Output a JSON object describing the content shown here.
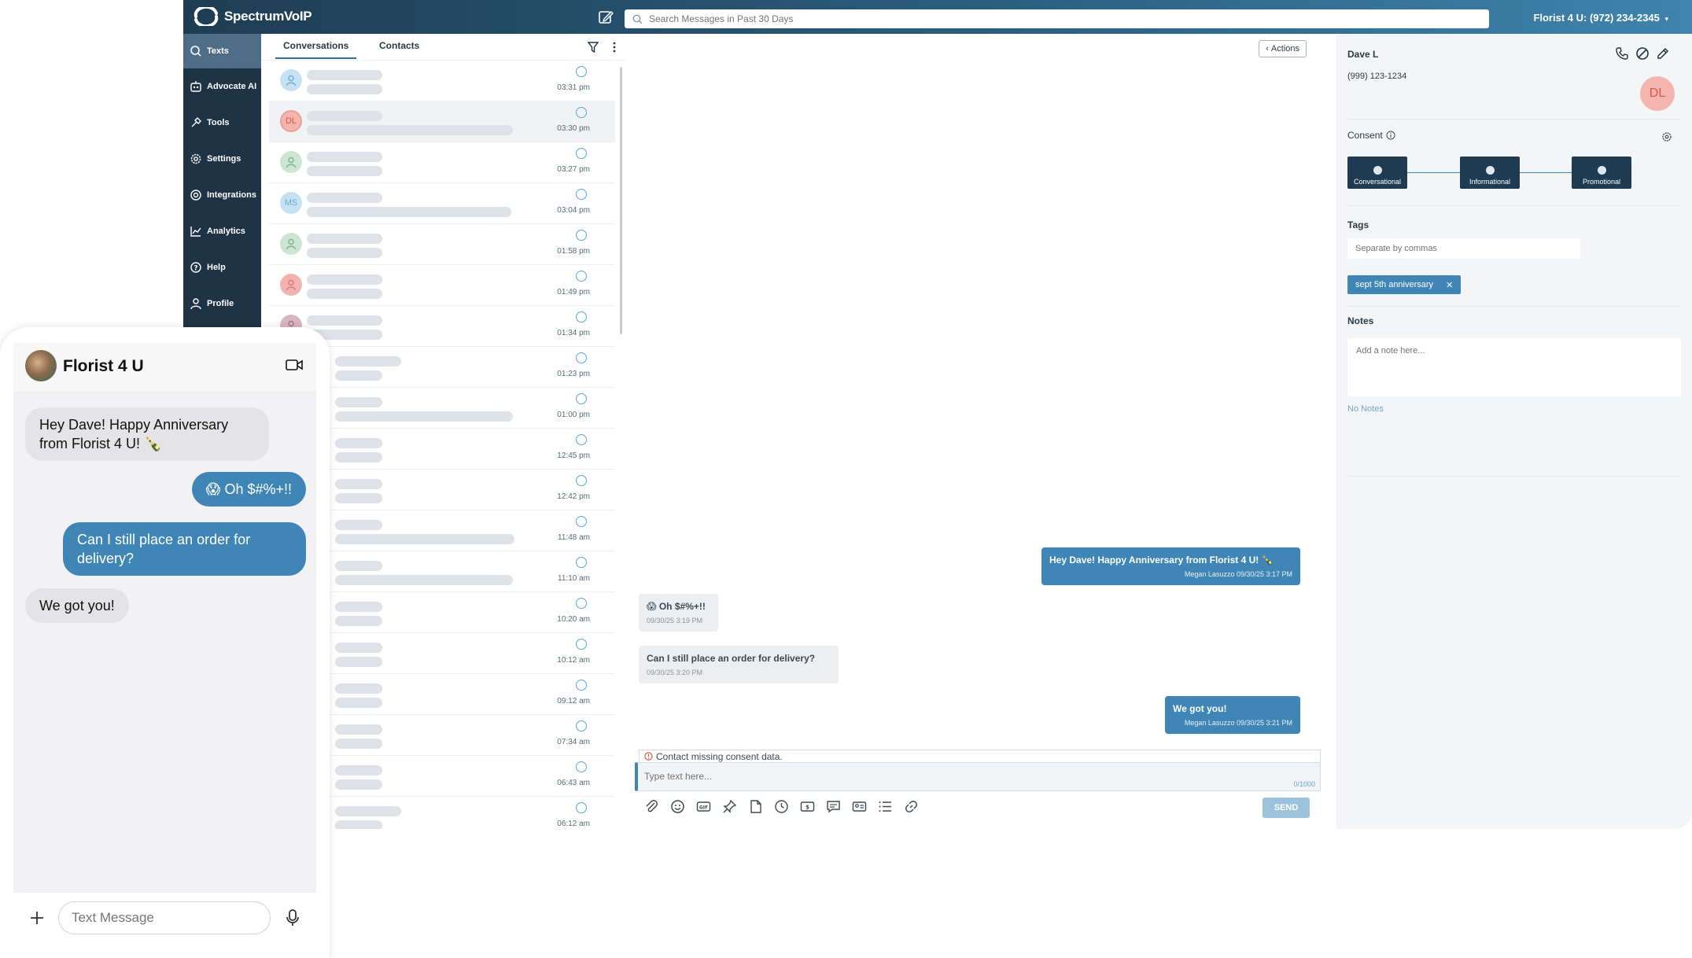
{
  "app": {
    "brand": "SpectrumVoIP",
    "search_placeholder": "Search Messages in Past 30 Days",
    "account": "Florist 4 U: (972) 234-2345"
  },
  "sidebar": {
    "items": [
      {
        "label": "Texts",
        "icon": "search-icon",
        "active": true
      },
      {
        "label": "Advocate AI",
        "icon": "robot-icon"
      },
      {
        "label": "Tools",
        "icon": "tools-icon"
      },
      {
        "label": "Settings",
        "icon": "gear-icon"
      },
      {
        "label": "Integrations",
        "icon": "integrations-icon"
      },
      {
        "label": "Analytics",
        "icon": "chart-icon"
      },
      {
        "label": "Help",
        "icon": "help-icon"
      },
      {
        "label": "Profile",
        "icon": "user-icon"
      }
    ]
  },
  "conversations": {
    "tabs": [
      "Conversations",
      "Contacts"
    ],
    "rows": [
      {
        "initials": "",
        "time": "03:31 pm",
        "avatar_bg": "#c6e2f2",
        "avatar_fg": "#6aaed6"
      },
      {
        "initials": "DL",
        "time": "03:30 pm",
        "avatar_bg": "#f4b5ae",
        "avatar_fg": "#d9574b",
        "selected": true
      },
      {
        "initials": "",
        "time": "03:27 pm",
        "avatar_bg": "#cfe5d3",
        "avatar_fg": "#7fb58a"
      },
      {
        "initials": "MS",
        "time": "03:04 pm",
        "avatar_bg": "#c6e2f2",
        "avatar_fg": "#6aaed6"
      },
      {
        "initials": "",
        "time": "01:58 pm",
        "avatar_bg": "#cfe5d3",
        "avatar_fg": "#7fb58a"
      },
      {
        "initials": "",
        "time": "01:49 pm",
        "avatar_bg": "#f2b4b1",
        "avatar_fg": "#e07873"
      },
      {
        "initials": "",
        "time": "01:34 pm",
        "avatar_bg": "#d8b7c2",
        "avatar_fg": "#a9738a"
      },
      {
        "initials": "",
        "time": "01:23 pm"
      },
      {
        "initials": "",
        "time": "01:00 pm"
      },
      {
        "initials": "",
        "time": "12:45 pm"
      },
      {
        "initials": "",
        "time": "12:42 pm"
      },
      {
        "initials": "",
        "time": "11:48 am"
      },
      {
        "initials": "",
        "time": "11:10 am"
      },
      {
        "initials": "",
        "time": "10:20 am"
      },
      {
        "initials": "",
        "time": "10:12 am"
      },
      {
        "initials": "",
        "time": "09:12 am"
      },
      {
        "initials": "",
        "time": "07:34 am"
      },
      {
        "initials": "",
        "time": "06:43 am"
      },
      {
        "initials": "",
        "time": "06:12 am"
      }
    ]
  },
  "chat": {
    "actions_label": "Actions",
    "messages": [
      {
        "dir": "out",
        "text": "Hey Dave! Happy Anniversary from Florist 4 U! 🍾",
        "meta": "Megan Lasuzzo 09/30/25 3:17 PM"
      },
      {
        "dir": "in",
        "text": "😱 Oh $#%+!!",
        "meta": "09/30/25 3:19 PM"
      },
      {
        "dir": "in",
        "text": "Can I still place an order for delivery?",
        "meta": "09/30/25 3:20 PM"
      },
      {
        "dir": "out",
        "text": "We got you!",
        "meta": "Megan Lasuzzo 09/30/25 3:21 PM"
      }
    ],
    "consent_warning": "Contact missing consent data.",
    "input_placeholder": "Type text here...",
    "counter": "0/1000",
    "send_label": "SEND"
  },
  "contact": {
    "name": "Dave L",
    "phone": "(999) 123-1234",
    "initials": "DL",
    "consent_label": "Consent",
    "consent_steps": [
      "Conversational",
      "Informational",
      "Promotional"
    ],
    "tags_label": "Tags",
    "tags_placeholder": "Separate by commas",
    "tags": [
      "sept 5th anniversary"
    ],
    "notes_label": "Notes",
    "notes_placeholder": "Add a note here...",
    "no_notes": "No Notes"
  },
  "phone": {
    "title": "Florist 4 U",
    "messages": [
      {
        "dir": "in",
        "text": "Hey Dave! Happy Anniversary from Florist 4 U! 🍾"
      },
      {
        "dir": "out",
        "text": "😱 Oh $#%+!!"
      },
      {
        "dir": "out",
        "text": "Can I still place an order for delivery?"
      },
      {
        "dir": "in",
        "text": "We got you!"
      }
    ],
    "input_placeholder": "Text Message"
  }
}
